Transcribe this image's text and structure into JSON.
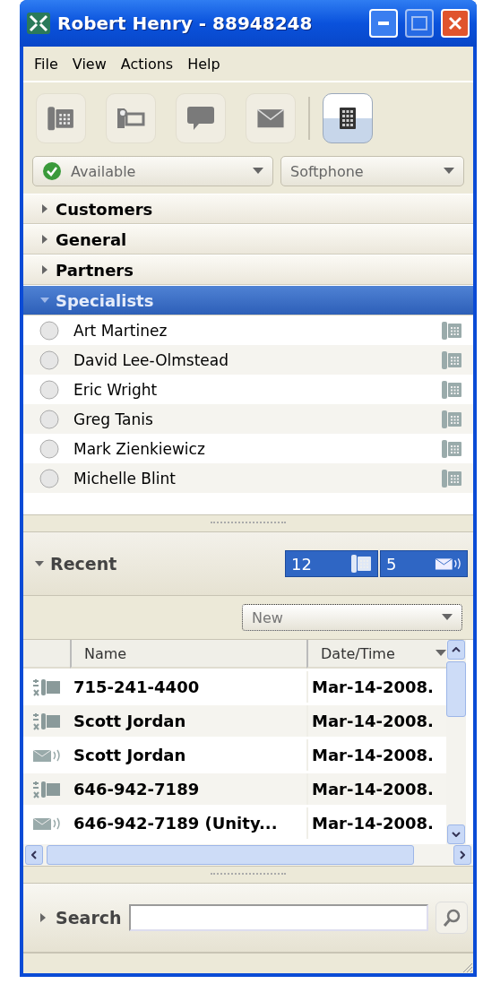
{
  "window": {
    "title": "Robert Henry - 88948248"
  },
  "menu": [
    "File",
    "View",
    "Actions",
    "Help"
  ],
  "toolbar": [
    {
      "kind": "phone",
      "selected": false
    },
    {
      "kind": "video",
      "selected": false
    },
    {
      "kind": "chat",
      "selected": false
    },
    {
      "kind": "mail",
      "selected": false
    },
    {
      "kind": "dialpad",
      "selected": true
    }
  ],
  "presence": {
    "value": "Available"
  },
  "device": {
    "value": "Softphone"
  },
  "groups": [
    {
      "label": "Customers",
      "expanded": false
    },
    {
      "label": "General",
      "expanded": false
    },
    {
      "label": "Partners",
      "expanded": false
    },
    {
      "label": "Specialists",
      "expanded": true,
      "children": [
        {
          "name": "Art Martinez"
        },
        {
          "name": "David Lee-Olmstead"
        },
        {
          "name": "Eric Wright"
        },
        {
          "name": "Greg Tanis"
        },
        {
          "name": "Mark Zienkiewicz"
        },
        {
          "name": "Michelle Blint"
        }
      ]
    }
  ],
  "recent": {
    "label": "Recent",
    "expanded": true,
    "badges": [
      {
        "kind": "calls",
        "count": "12"
      },
      {
        "kind": "voicemail",
        "count": "5"
      }
    ],
    "filter": "New",
    "columns": [
      "Name",
      "Date/Time"
    ],
    "rows": [
      {
        "kind": "call",
        "name": "715-241-4400",
        "date": "Mar-14-2008."
      },
      {
        "kind": "call",
        "name": "Scott Jordan",
        "date": "Mar-14-2008."
      },
      {
        "kind": "voicemail",
        "name": "Scott Jordan",
        "date": "Mar-14-2008."
      },
      {
        "kind": "call",
        "name": "646-942-7189",
        "date": "Mar-14-2008."
      },
      {
        "kind": "voicemail",
        "name": "646-942-7189 (Unity...",
        "date": "Mar-14-2008."
      }
    ]
  },
  "search": {
    "label": "Search",
    "expanded": false
  }
}
